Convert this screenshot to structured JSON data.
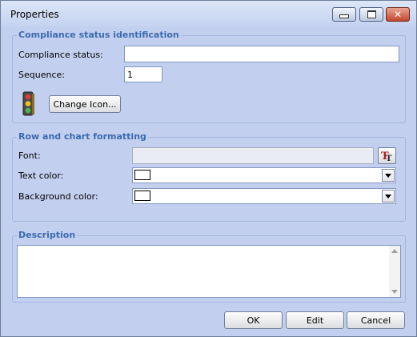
{
  "window": {
    "title": "Properties"
  },
  "compliance_group": {
    "legend": "Compliance status identification",
    "status_label": "Compliance status:",
    "status_value": "",
    "sequence_label": "Sequence:",
    "sequence_value": "1",
    "icon": "traffic-light-icon",
    "change_icon_label": "Change Icon..."
  },
  "formatting_group": {
    "legend": "Row and chart formatting",
    "font_label": "Font:",
    "font_value": "",
    "font_button_icon": "font-picker-icon",
    "text_color_label": "Text color:",
    "text_color": "#FFFFFF",
    "bg_color_label": "Background color:",
    "bg_color": "#FFFFFF"
  },
  "description_group": {
    "legend": "Description",
    "value": ""
  },
  "buttons": {
    "ok": "OK",
    "edit": "Edit",
    "cancel": "Cancel"
  },
  "colors": {
    "accent": "#3C6BB0",
    "background": "#C2CFEF"
  }
}
